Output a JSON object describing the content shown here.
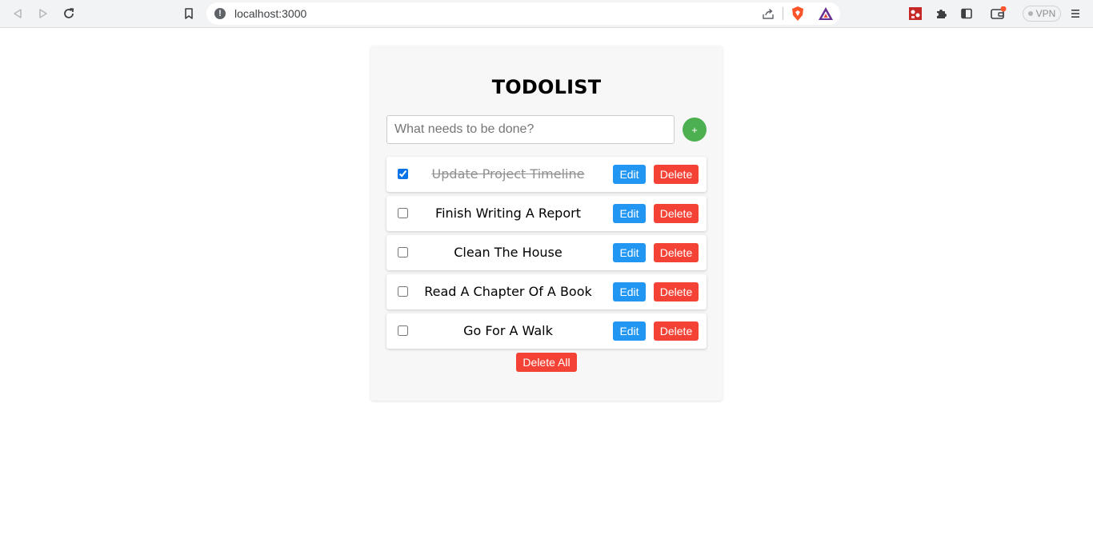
{
  "browser": {
    "url": "localhost:3000",
    "vpn_label": "VPN",
    "icons": [
      "back-icon",
      "forward-icon",
      "reload-icon",
      "bookmark-icon",
      "site-info-icon",
      "share-icon",
      "brave-shield-icon",
      "brave-rewards-icon",
      "extension-icon",
      "puzzle-icon",
      "sidebar-icon",
      "wallet-icon",
      "menu-icon"
    ]
  },
  "app": {
    "title": "TODOLIST",
    "input_placeholder": "What needs to be done?",
    "input_value": "",
    "add_label": "+",
    "edit_label": "Edit",
    "delete_label": "Delete",
    "delete_all_label": "Delete All",
    "todos": [
      {
        "text": "Update Project Timeline",
        "completed": true
      },
      {
        "text": "Finish Writing A Report",
        "completed": false
      },
      {
        "text": "Clean The House",
        "completed": false
      },
      {
        "text": "Read A Chapter Of A Book",
        "completed": false
      },
      {
        "text": "Go For A Walk",
        "completed": false
      }
    ]
  },
  "colors": {
    "add": "#4caf50",
    "edit": "#2196f3",
    "delete": "#f44336",
    "checkbox": "#0b73e8"
  }
}
